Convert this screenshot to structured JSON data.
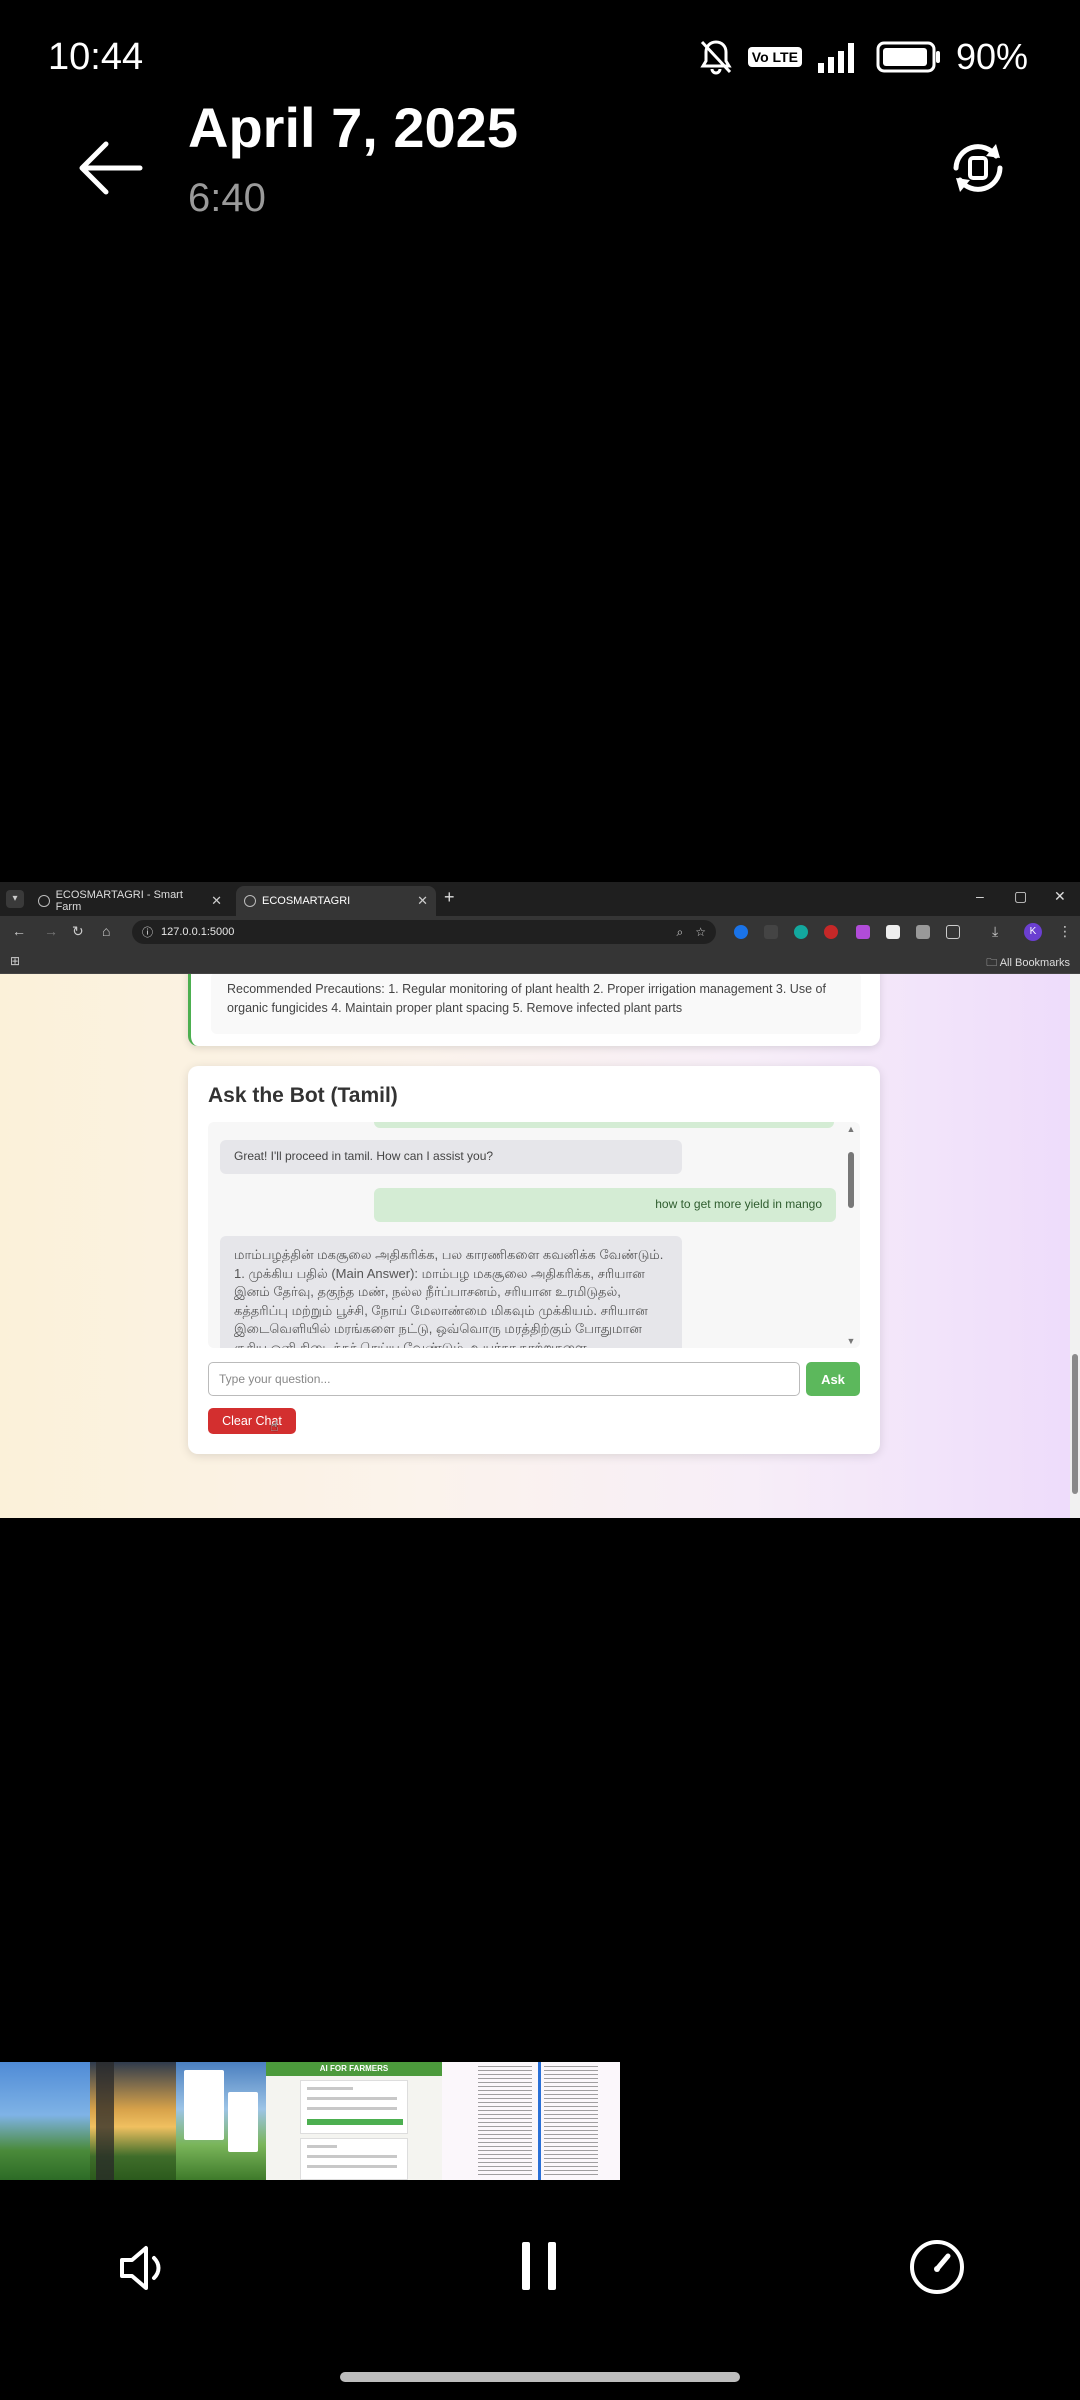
{
  "status_bar": {
    "time": "10:44",
    "network_badge": "Vo LTE",
    "battery": "90%",
    "icons": [
      "mute-bell-icon",
      "volte-icon",
      "signal-icon",
      "battery-icon"
    ]
  },
  "header": {
    "date": "April 7, 2025",
    "time": "6:40",
    "icons": [
      "back-arrow-icon",
      "rotate-icon"
    ]
  },
  "browser": {
    "tabs": [
      {
        "label": "ECOSMARTAGRI - Smart Farm"
      },
      {
        "label": "ECOSMARTAGRI"
      }
    ],
    "url": "127.0.0.1:5000",
    "all_bookmarks": "All Bookmarks",
    "profile_initial": "K"
  },
  "page": {
    "precautions_text": "Recommended Precautions: 1. Regular monitoring of plant health 2. Proper irrigation management 3. Use of organic fungicides 4. Maintain proper plant spacing 5. Remove infected plant parts",
    "chat": {
      "title": "Ask the Bot (Tamil)",
      "messages": [
        {
          "role": "bot",
          "text": "Great! I'll proceed in tamil. How can I assist you?"
        },
        {
          "role": "user",
          "text": "how to get more yield in mango"
        },
        {
          "role": "bot",
          "text": "மாம்பழத்தின் மகசூலை அதிகரிக்க, பல காரணிகளை கவனிக்க வேண்டும். 1. முக்கிய பதில் (Main Answer): மாம்பழ மகசூலை அதிகரிக்க, சரியான இனம் தேர்வு, தகுந்த மண், நல்ல நீர்ப்பாசனம், சரியான உரமிடுதல், கத்தரிப்பு மற்றும் பூச்சி, நோய் மேலாண்மை மிகவும் முக்கியம். சரியான இடைவெளியில் மரங்களை நட்டு, ஒவ்வொரு மரத்திற்கும் போதுமான சூரிய ஒளி கிடைக்கச் செய்ய வேண்டும். உயர்தர நாற்றுகளை"
        }
      ],
      "input_placeholder": "Type your question...",
      "ask_label": "Ask",
      "clear_label": "Clear Chat"
    }
  },
  "thumbnails": {
    "form_title": "AI FOR FARMERS"
  },
  "controls": {
    "icons": [
      "volume-icon",
      "pause-icon",
      "speed-icon"
    ]
  },
  "colors": {
    "ask_button": "#5cb85c",
    "clear_button": "#d32f2f",
    "user_bubble": "#d4ecd4",
    "bot_bubble": "#e6e6ea"
  }
}
